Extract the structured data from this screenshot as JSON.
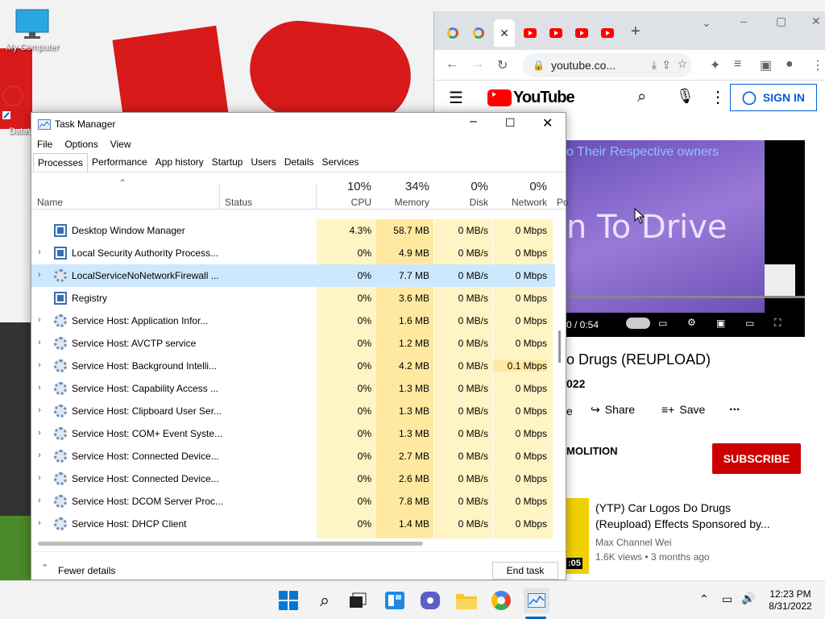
{
  "desktop": {
    "icons": [
      {
        "label": "My Computer",
        "icon": "monitor-icon"
      },
      {
        "label": "DataW",
        "icon": "shortcut-icon"
      }
    ]
  },
  "chrome": {
    "tabs": [
      "google-icon",
      "google-icon",
      "close-icon",
      "youtube-icon",
      "youtube-icon",
      "youtube-icon",
      "youtube-icon"
    ],
    "new_tab": "+",
    "address": "youtube.co...",
    "window_controls": [
      "⌄",
      "–",
      "▢",
      "✕"
    ]
  },
  "youtube": {
    "logo": "YouTube",
    "sign_in": "SIGN IN",
    "video_overlay_top": "o Their Respective owners",
    "video_overlay_main": "n To Drive",
    "video_time": "0 / 0:54",
    "title": "o Drugs (REUPLOAD)",
    "date": "022",
    "actions": {
      "share": "Share",
      "save": "Save",
      "more": "...",
      "left": "e"
    },
    "channel": "MOLITION",
    "subscribe": "SUBSCRIBE",
    "rec": {
      "title": "(YTP) Car Logos Do Drugs (Reupload) Effects Sponsored by...",
      "channel": "Max Channel Wei",
      "meta": "1.6K views • 3 months ago",
      "duration": ":05"
    }
  },
  "taskmanager": {
    "title": "Task Manager",
    "menu": [
      "File",
      "Options",
      "View"
    ],
    "tabs": [
      "Processes",
      "Performance",
      "App history",
      "Startup",
      "Users",
      "Details",
      "Services"
    ],
    "selected_tab": "Processes",
    "columns": {
      "name": "Name",
      "status": "Status",
      "cpu_pct": "10%",
      "cpu": "CPU",
      "mem_pct": "34%",
      "mem": "Memory",
      "disk_pct": "0%",
      "disk": "Disk",
      "net_pct": "0%",
      "net": "Network",
      "power": "Po"
    },
    "rows": [
      {
        "name": "Desktop Window Manager",
        "cpu": "4.3%",
        "mem": "58.7 MB",
        "disk": "0 MB/s",
        "net": "0 Mbps",
        "expand": false,
        "icon": "window"
      },
      {
        "name": "Local Security Authority Process...",
        "cpu": "0%",
        "mem": "4.9 MB",
        "disk": "0 MB/s",
        "net": "0 Mbps",
        "expand": true,
        "icon": "window"
      },
      {
        "name": "LocalServiceNoNetworkFirewall ...",
        "cpu": "0%",
        "mem": "7.7 MB",
        "disk": "0 MB/s",
        "net": "0 Mbps",
        "expand": true,
        "icon": "gear",
        "selected": true
      },
      {
        "name": "Registry",
        "cpu": "0%",
        "mem": "3.6 MB",
        "disk": "0 MB/s",
        "net": "0 Mbps",
        "expand": false,
        "icon": "window"
      },
      {
        "name": "Service Host: Application Infor...",
        "cpu": "0%",
        "mem": "1.6 MB",
        "disk": "0 MB/s",
        "net": "0 Mbps",
        "expand": true,
        "icon": "gear"
      },
      {
        "name": "Service Host: AVCTP service",
        "cpu": "0%",
        "mem": "1.2 MB",
        "disk": "0 MB/s",
        "net": "0 Mbps",
        "expand": true,
        "icon": "gear"
      },
      {
        "name": "Service Host: Background Intelli...",
        "cpu": "0%",
        "mem": "4.2 MB",
        "disk": "0 MB/s",
        "net": "0.1 Mbps",
        "expand": true,
        "icon": "gear"
      },
      {
        "name": "Service Host: Capability Access ...",
        "cpu": "0%",
        "mem": "1.3 MB",
        "disk": "0 MB/s",
        "net": "0 Mbps",
        "expand": true,
        "icon": "gear"
      },
      {
        "name": "Service Host: Clipboard User Ser...",
        "cpu": "0%",
        "mem": "1.3 MB",
        "disk": "0 MB/s",
        "net": "0 Mbps",
        "expand": true,
        "icon": "gear"
      },
      {
        "name": "Service Host: COM+ Event Syste...",
        "cpu": "0%",
        "mem": "1.3 MB",
        "disk": "0 MB/s",
        "net": "0 Mbps",
        "expand": true,
        "icon": "gear"
      },
      {
        "name": "Service Host: Connected Device...",
        "cpu": "0%",
        "mem": "2.7 MB",
        "disk": "0 MB/s",
        "net": "0 Mbps",
        "expand": true,
        "icon": "gear"
      },
      {
        "name": "Service Host: Connected Device...",
        "cpu": "0%",
        "mem": "2.6 MB",
        "disk": "0 MB/s",
        "net": "0 Mbps",
        "expand": true,
        "icon": "gear"
      },
      {
        "name": "Service Host: DCOM Server Proc...",
        "cpu": "0%",
        "mem": "7.8 MB",
        "disk": "0 MB/s",
        "net": "0 Mbps",
        "expand": true,
        "icon": "gear"
      },
      {
        "name": "Service Host: DHCP Client",
        "cpu": "0%",
        "mem": "1.4 MB",
        "disk": "0 MB/s",
        "net": "0 Mbps",
        "expand": true,
        "icon": "gear"
      }
    ],
    "fewer_details": "Fewer details",
    "end_task": "End task"
  },
  "taskbar": {
    "apps": [
      "windows-start-icon",
      "search-icon",
      "task-view-icon",
      "widgets-icon",
      "chat-icon",
      "file-explorer-icon",
      "chrome-icon",
      "task-manager-icon"
    ],
    "time": "12:23 PM",
    "date": "8/31/2022"
  },
  "colors": {
    "accent": "#0067c0",
    "youtube_red": "#ff0000",
    "subscribe": "#cc0000",
    "heat": "#fff4c4",
    "heat_strong": "#ffe9a0",
    "selected_row": "#cce8ff"
  }
}
